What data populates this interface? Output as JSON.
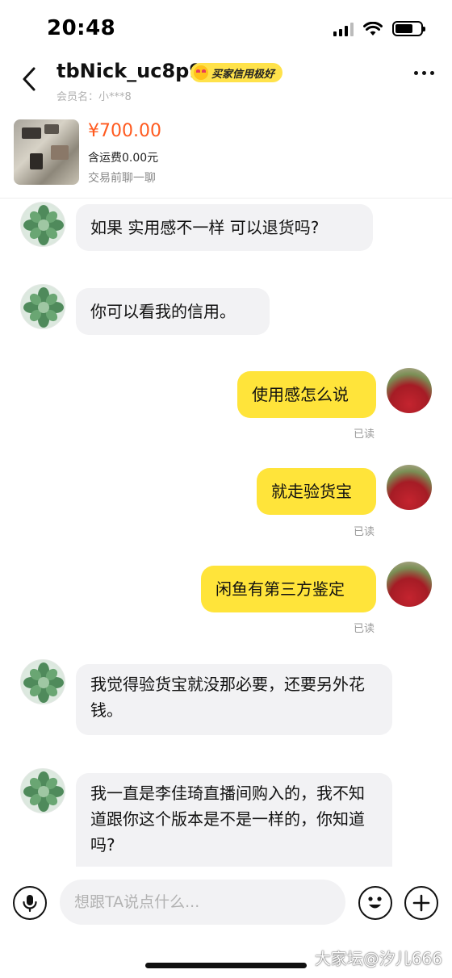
{
  "status_bar": {
    "time": "20:48",
    "battery_level": 0.7
  },
  "header": {
    "contact_name": "tbNick_uc8p9",
    "credit_badge": "买家信用极好",
    "member_line": "会员名：小***8"
  },
  "product": {
    "price": "¥700.00",
    "shipping": "含运费0.00元",
    "note": "交易前聊一聊"
  },
  "messages": [
    {
      "side": "left",
      "text": "如果 实用感不一样 可以退货吗?"
    },
    {
      "side": "left",
      "text": "你可以看我的信用。"
    },
    {
      "side": "right",
      "text": "使用感怎么说",
      "status": "已读"
    },
    {
      "side": "right",
      "text": "就走验货宝",
      "status": "已读"
    },
    {
      "side": "right",
      "text": "闲鱼有第三方鉴定",
      "status": "已读"
    },
    {
      "side": "left",
      "text": "我觉得验货宝就没那必要，还要另外花钱。"
    },
    {
      "side": "left",
      "text": "我一直是李佳琦直播间购入的，我不知道跟你这个版本是不是一样的，你知道吗?"
    }
  ],
  "input": {
    "placeholder": "想跟TA说点什么..."
  },
  "watermark": "大家坛@汐儿666",
  "colors": {
    "accent": "#ffe43a",
    "price": "#ff5a1f",
    "left_bubble": "#f2f2f4"
  }
}
